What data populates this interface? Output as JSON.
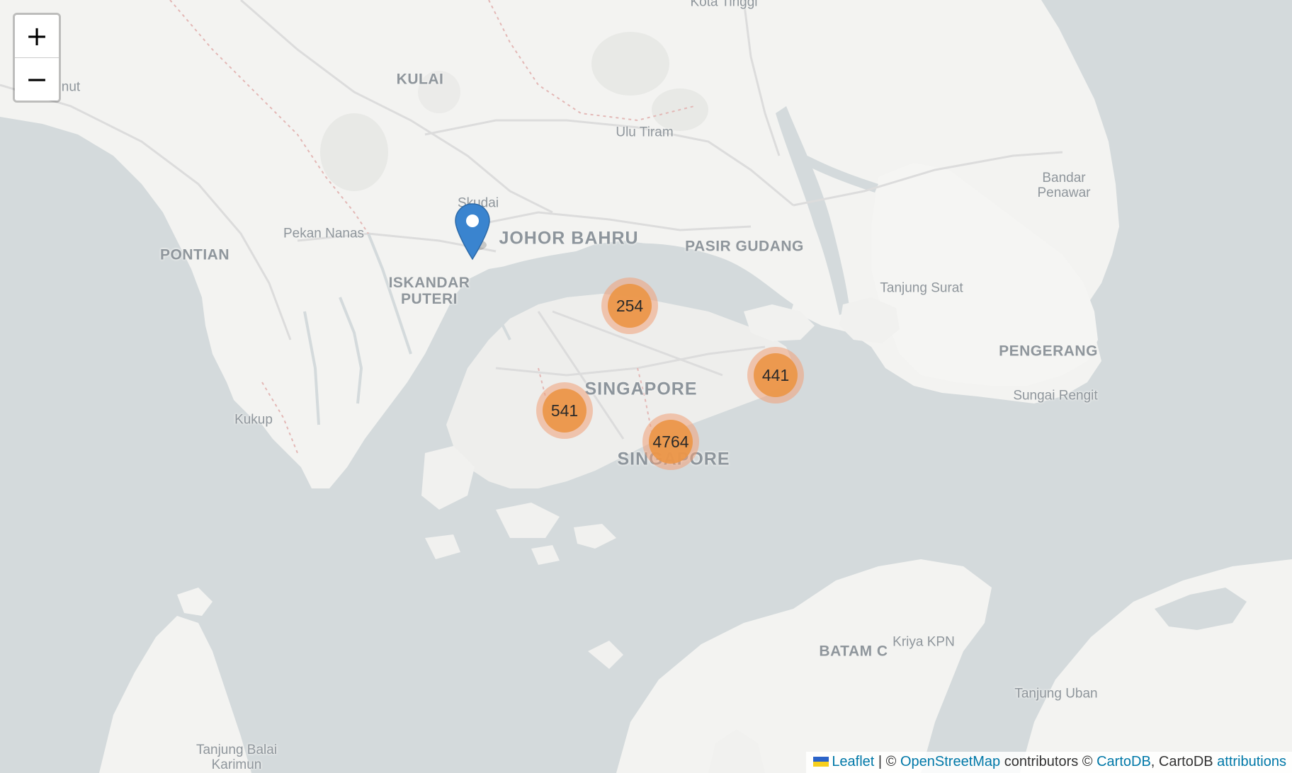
{
  "map": {
    "zoom_in_label": "+",
    "zoom_out_label": "−",
    "place_labels": {
      "kota_tinggi": "Kota Tinggi",
      "kulai": "KULAI",
      "ulu_tiram": "Ulu Tiram",
      "skudai": "Skudai",
      "johor_bahru": "JOHOR BAHRU",
      "pasir_gudang": "PASIR GUDANG",
      "pekan_nanas": "Pekan Nanas",
      "pontian": "PONTIAN",
      "iskandar_puteri": "ISKANDAR PUTERI",
      "bandar_penawar": "Bandar Penawar",
      "tanjung_surat": "Tanjung Surat",
      "pengerang": "PENGERANG",
      "sungai_rengit": "Sungai Rengit",
      "singapore_region": "SINGAPORE",
      "singapore_city": "SINGAPORE",
      "kukup": "Kukup",
      "batam": "BATAM C",
      "kriya_kpn": "Kriya KPN",
      "tanjung_uban": "Tanjung Uban",
      "tanjung_balai_karimun": "Tanjung Balai Karimun",
      "edge_label": "nut"
    },
    "clusters": [
      {
        "count": "254"
      },
      {
        "count": "441"
      },
      {
        "count": "541"
      },
      {
        "count": "4764"
      }
    ],
    "marker_icon": "map-pin-icon",
    "cluster_color": "#ec9646",
    "marker_color": "#2f7fd0"
  },
  "attribution": {
    "leaflet": "Leaflet",
    "sep": " | © ",
    "osm": "OpenStreetMap",
    "contributors": " contributors © ",
    "cartodb": "CartoDB",
    "comma": ", CartoDB ",
    "attributions": "attributions"
  }
}
